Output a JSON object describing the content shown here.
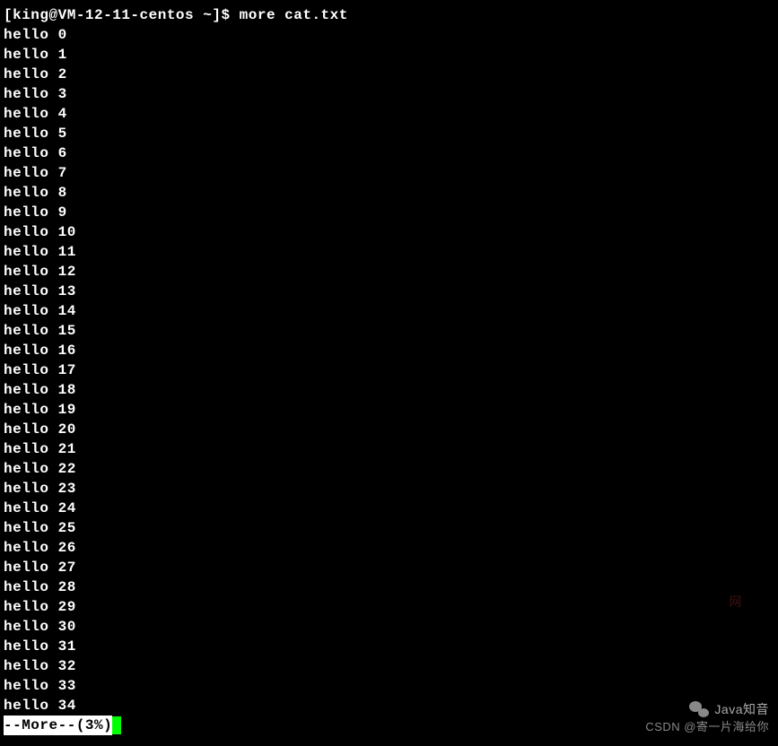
{
  "prompt": "[king@VM-12-11-centos ~]$ more cat.txt",
  "lines": [
    "hello 0",
    "hello 1",
    "hello 2",
    "hello 3",
    "hello 4",
    "hello 5",
    "hello 6",
    "hello 7",
    "hello 8",
    "hello 9",
    "hello 10",
    "hello 11",
    "hello 12",
    "hello 13",
    "hello 14",
    "hello 15",
    "hello 16",
    "hello 17",
    "hello 18",
    "hello 19",
    "hello 20",
    "hello 21",
    "hello 22",
    "hello 23",
    "hello 24",
    "hello 25",
    "hello 26",
    "hello 27",
    "hello 28",
    "hello 29",
    "hello 30",
    "hello 31",
    "hello 32",
    "hello 33",
    "hello 34"
  ],
  "more_status": "--More--(3%)",
  "watermark_top": "Java知音",
  "watermark_bottom": "CSDN @寄一片海给你",
  "watermark_red": "网"
}
